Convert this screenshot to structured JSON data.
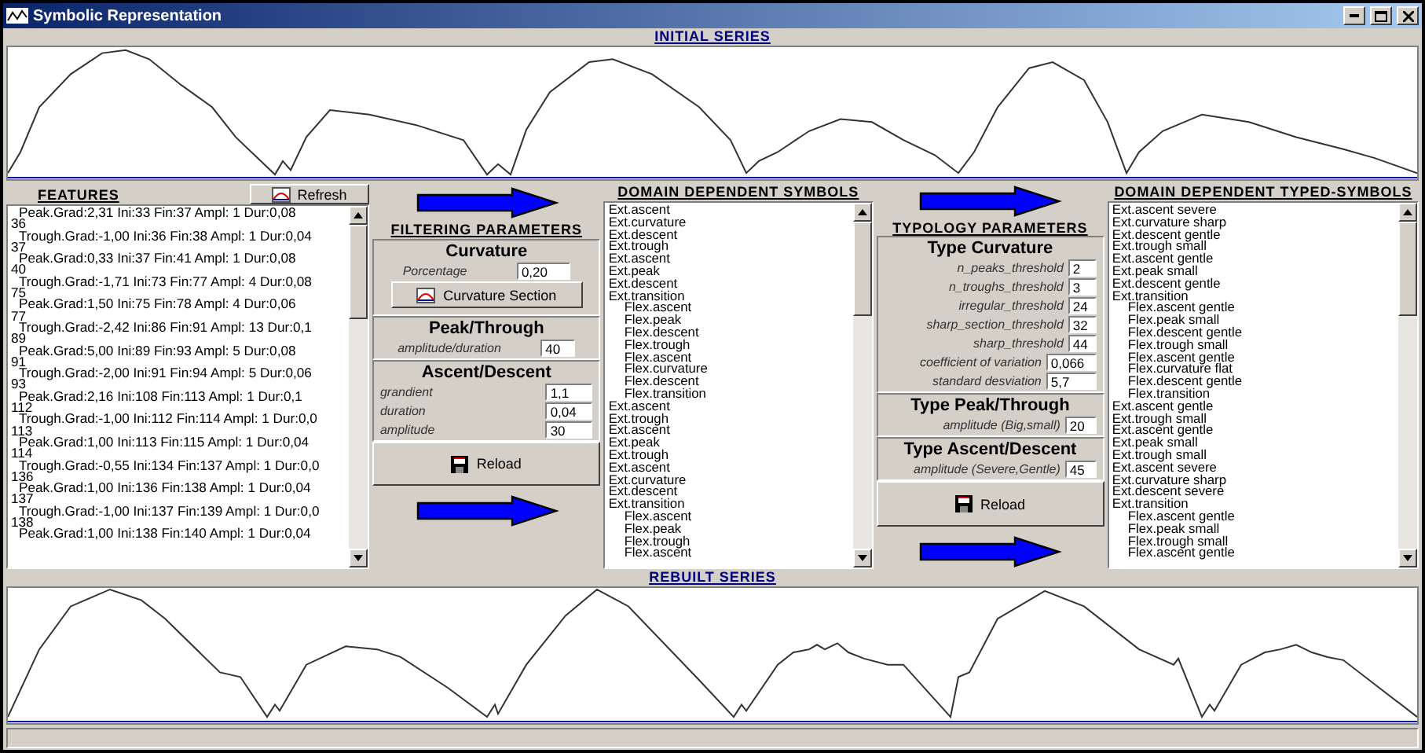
{
  "window": {
    "title": "Symbolic Representation"
  },
  "initial_series": {
    "title": "INITIAL SERIES"
  },
  "features": {
    "title": "FEATURES",
    "refresh_button": "Refresh",
    "items": [
      {
        "text": "Peak.Grad:2,31 Ini:33 Fin:37 Ampl: 1 Dur:0,08",
        "index": "36"
      },
      {
        "text": "Trough.Grad:-1,00 Ini:36 Fin:38 Ampl: 1 Dur:0,04",
        "index": "37"
      },
      {
        "text": "Peak.Grad:0,33 Ini:37 Fin:41 Ampl: 1 Dur:0,08",
        "index": "40"
      },
      {
        "text": "Trough.Grad:-1,71 Ini:73 Fin:77 Ampl: 4 Dur:0,08",
        "index": "75"
      },
      {
        "text": "Peak.Grad:1,50 Ini:75 Fin:78 Ampl: 4 Dur:0,06",
        "index": "77"
      },
      {
        "text": "Trough.Grad:-2,42 Ini:86 Fin:91 Ampl: 13 Dur:0,1",
        "index": "89"
      },
      {
        "text": "Peak.Grad:5,00 Ini:89 Fin:93 Ampl: 5 Dur:0,08",
        "index": "91"
      },
      {
        "text": "Trough.Grad:-2,00 Ini:91 Fin:94 Ampl: 5 Dur:0,06",
        "index": "93"
      },
      {
        "text": "Peak.Grad:2,16 Ini:108 Fin:113 Ampl: 1 Dur:0,1",
        "index": "112"
      },
      {
        "text": "Trough.Grad:-1,00 Ini:112 Fin:114 Ampl: 1 Dur:0,0",
        "index": "113"
      },
      {
        "text": "Peak.Grad:1,00 Ini:113 Fin:115 Ampl: 1 Dur:0,04",
        "index": "114"
      },
      {
        "text": "Trough.Grad:-0,55 Ini:134 Fin:137 Ampl: 1 Dur:0,0",
        "index": "136"
      },
      {
        "text": "Peak.Grad:1,00 Ini:136 Fin:138 Ampl: 1 Dur:0,04",
        "index": "137"
      },
      {
        "text": "Trough.Grad:-1,00 Ini:137 Fin:139 Ampl: 1 Dur:0,0",
        "index": "138"
      },
      {
        "text": "Peak.Grad:1,00 Ini:138 Fin:140 Ampl: 1 Dur:0,04"
      }
    ]
  },
  "filtering": {
    "title": "FILTERING PARAMETERS",
    "curvature": {
      "title": "Curvature",
      "label": "Porcentage",
      "value": "0,20",
      "button": "Curvature Section"
    },
    "peak_through": {
      "title": "Peak/Through",
      "label": "amplitude/duration",
      "value": "40"
    },
    "ascent_descent": {
      "title": "Ascent/Descent",
      "fields": [
        {
          "label": "grandient",
          "value": "1,1"
        },
        {
          "label": "duration",
          "value": "0,04"
        },
        {
          "label": "amplitude",
          "value": "30"
        }
      ]
    },
    "reload_button": "Reload"
  },
  "domain_symbols": {
    "title": "DOMAIN DEPENDENT SYMBOLS",
    "items": [
      {
        "text": "Ext.ascent"
      },
      {
        "text": "Ext.curvature"
      },
      {
        "text": "Ext.descent"
      },
      {
        "text": "Ext.trough"
      },
      {
        "text": "Ext.ascent"
      },
      {
        "text": "Ext.peak"
      },
      {
        "text": "Ext.descent"
      },
      {
        "text": "Ext.transition",
        "children": [
          {
            "text": "Flex.ascent"
          },
          {
            "text": "Flex.peak"
          },
          {
            "text": "Flex.descent"
          },
          {
            "text": "Flex.trough"
          },
          {
            "text": "Flex.ascent"
          },
          {
            "text": "Flex.curvature"
          },
          {
            "text": "Flex.descent"
          },
          {
            "text": "Flex.transition"
          }
        ]
      },
      {
        "text": "Ext.ascent"
      },
      {
        "text": "Ext.trough"
      },
      {
        "text": "Ext.ascent"
      },
      {
        "text": "Ext.peak"
      },
      {
        "text": "Ext.trough"
      },
      {
        "text": "Ext.ascent"
      },
      {
        "text": "Ext.curvature"
      },
      {
        "text": "Ext.descent"
      },
      {
        "text": "Ext.transition",
        "children": [
          {
            "text": "Flex.ascent"
          },
          {
            "text": "Flex.peak"
          },
          {
            "text": "Flex.trough"
          },
          {
            "text": "Flex.ascent"
          }
        ]
      }
    ]
  },
  "typology": {
    "title": "TYPOLOGY PARAMETERS",
    "curvature": {
      "title": "Type Curvature",
      "fields": [
        {
          "label": "n_peaks_threshold",
          "value": "2"
        },
        {
          "label": "n_troughs_threshold",
          "value": "3"
        },
        {
          "label": "irregular_threshold",
          "value": "24"
        },
        {
          "label": "sharp_section_threshold",
          "value": "32"
        },
        {
          "label": "sharp_threshold",
          "value": "44"
        },
        {
          "label": "coefficient of variation",
          "value": "0,066"
        },
        {
          "label": "standard desviation",
          "value": "5,7"
        }
      ]
    },
    "peak_through": {
      "title": "Type Peak/Through",
      "label": "amplitude (Big,small)",
      "value": "20"
    },
    "ascent_descent": {
      "title": "Type Ascent/Descent",
      "label": "amplitude (Severe,Gentle)",
      "value": "45"
    },
    "reload_button": "Reload"
  },
  "typed_symbols": {
    "title": "DOMAIN DEPENDENT TYPED-SYMBOLS",
    "items": [
      {
        "text": "Ext.ascent severe"
      },
      {
        "text": "Ext.curvature sharp"
      },
      {
        "text": "Ext.descent gentle"
      },
      {
        "text": "Ext.trough small"
      },
      {
        "text": "Ext.ascent gentle"
      },
      {
        "text": "Ext.peak small"
      },
      {
        "text": "Ext.descent gentle"
      },
      {
        "text": "Ext.transition",
        "children": [
          {
            "text": "Flex.ascent gentle"
          },
          {
            "text": "Flex.peak small"
          },
          {
            "text": "Flex.descent gentle"
          },
          {
            "text": "Flex.trough small"
          },
          {
            "text": "Flex.ascent gentle"
          },
          {
            "text": "Flex.curvature flat"
          },
          {
            "text": "Flex.descent gentle"
          },
          {
            "text": "Flex.transition"
          }
        ]
      },
      {
        "text": "Ext.ascent gentle"
      },
      {
        "text": "Ext.trough small"
      },
      {
        "text": "Ext.ascent gentle"
      },
      {
        "text": "Ext.peak small"
      },
      {
        "text": "Ext.trough small"
      },
      {
        "text": "Ext.ascent severe"
      },
      {
        "text": "Ext.curvature sharp"
      },
      {
        "text": "Ext.descent severe"
      },
      {
        "text": "Ext.transition",
        "children": [
          {
            "text": "Flex.ascent gentle"
          },
          {
            "text": "Flex.peak small"
          },
          {
            "text": "Flex.trough small"
          },
          {
            "text": "Flex.ascent gentle"
          }
        ]
      }
    ]
  },
  "rebuilt_series": {
    "title": "REBUILT SERIES"
  }
}
